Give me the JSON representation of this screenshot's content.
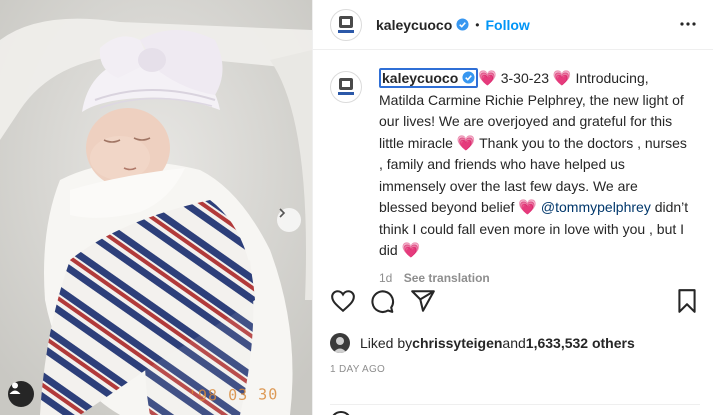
{
  "photo": {
    "date_stamp": "'98 03 30",
    "next_icon": "chevron-right-icon",
    "tag_icon": "user-tag-icon"
  },
  "header": {
    "username": "kaleycuoco",
    "separator": "•",
    "follow_label": "Follow",
    "more_icon": "more-horizontal-icon",
    "verified_icon": "verified-badge-icon"
  },
  "caption": {
    "username": "kaleycuoco",
    "part1": " 3-30-23 ",
    "part2": " Introducing, Matilda Carmine Richie Pelphrey, the new light of our lives! We are overjoyed and grateful for this little miracle ",
    "part3": " Thank you to the doctors , nurses , family and friends who have helped us immensely over the last few days. We are blessed beyond belief ",
    "mention": "@tommypelphrey",
    "part4": " didn’t think I could fall even more in love with you , but I did ",
    "heart": "💗",
    "age": "1d",
    "see_translation": "See translation"
  },
  "actions": {
    "like_icon": "heart-icon",
    "comment_icon": "comment-icon",
    "share_icon": "share-icon",
    "save_icon": "bookmark-icon"
  },
  "likes": {
    "prefix": "Liked by ",
    "liker": "chrissyteigen",
    "middle": " and ",
    "count": "1,633,532 others"
  },
  "posted": "1 DAY AGO",
  "colors": {
    "accent": "#0095f6",
    "verified": "#3897f0",
    "heart": "#e83f8c",
    "muted": "#8e8e8e"
  }
}
